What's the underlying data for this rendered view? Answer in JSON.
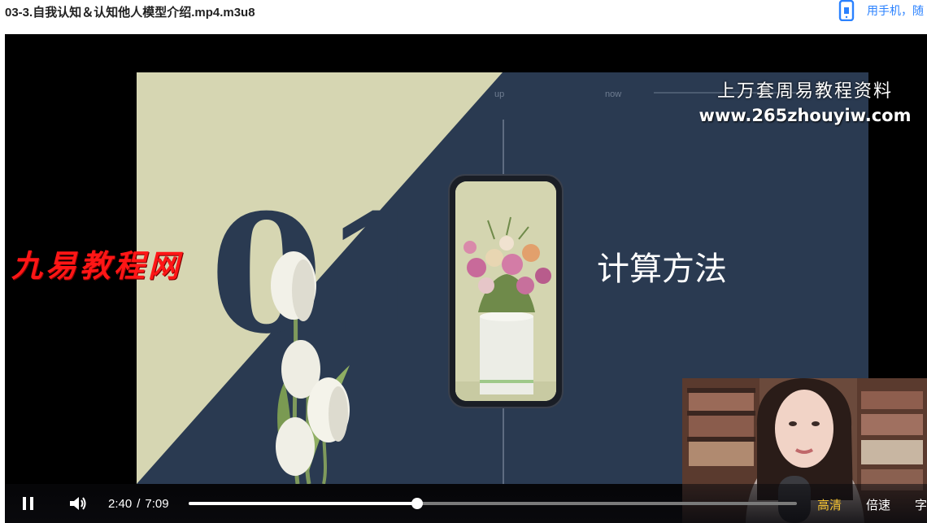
{
  "header": {
    "file_title": "03-3.自我认知＆认知他人模型介绍.mp4.m3u8",
    "mobile_link_text": "用手机，随",
    "mobile_icon": "smartphone-icon",
    "link_color": "#2b82ff"
  },
  "watermarks": {
    "top_right_line1": "上万套周易教程资料",
    "top_right_line2": "www.265zhouyiw.com",
    "left": "九易教程网",
    "left_color": "#ff1616"
  },
  "slide": {
    "nav_up": "up",
    "nav_now": "now",
    "nav_page": "01",
    "big_number": "01",
    "heading": "计算方法",
    "colors": {
      "cream": "#d6d6b2",
      "navy": "#2a3a51"
    }
  },
  "controls": {
    "play_icon": "pause-icon",
    "volume_icon": "volume-icon",
    "current_time": "2:40",
    "separator": "/",
    "duration": "7:09",
    "progress": 0.375,
    "quality_label": "高清",
    "speed_label": "倍速",
    "subtitle_label": "字",
    "quality_color": "#f5c332"
  }
}
